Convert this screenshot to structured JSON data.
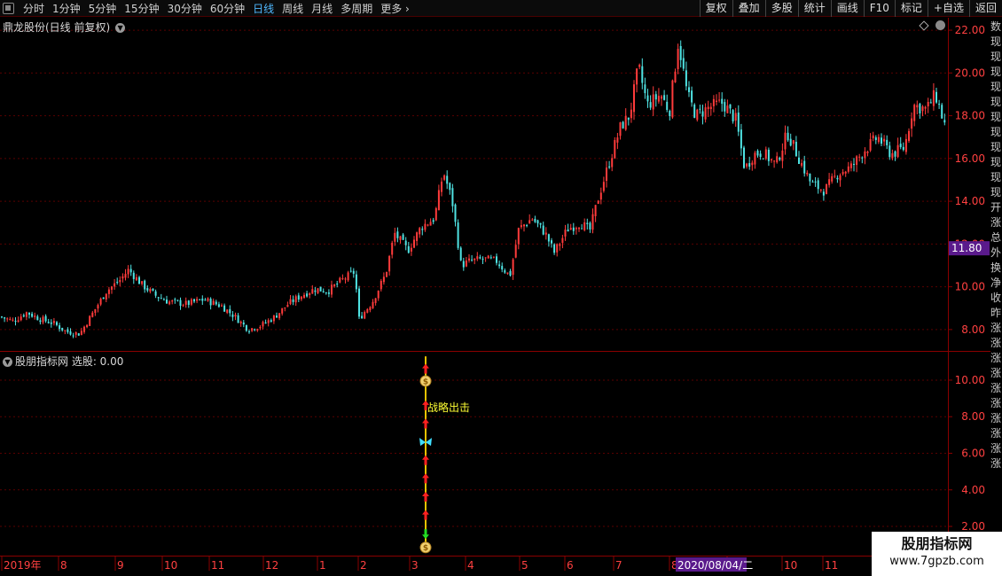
{
  "toolbar": {
    "periods": [
      "分时",
      "1分钟",
      "5分钟",
      "15分钟",
      "30分钟",
      "60分钟",
      "日线",
      "周线",
      "月线",
      "多周期",
      "更多 ›"
    ],
    "active_period": "日线",
    "right_tools": [
      "复权",
      "叠加",
      "多股",
      "统计",
      "画线",
      "F10",
      "标记",
      "+自选",
      "返回"
    ]
  },
  "price_panel": {
    "title": "鼎龙股份(日线 前复权)",
    "current_price_label": "11.80"
  },
  "indicator_panel": {
    "title": "股朋指标网  选股: 0.00",
    "annotation": "战略出击"
  },
  "x_axis": {
    "labels": [
      "2019年",
      "8",
      "9",
      "10",
      "11",
      "12",
      "1",
      "2",
      "3",
      "4",
      "5",
      "6",
      "7",
      "8",
      "9",
      "10",
      "11"
    ],
    "highlight_date": "2020/08/04/二"
  },
  "side_strip_chars": [
    "数",
    "现",
    "现",
    "现",
    "现",
    "现",
    "现",
    "现",
    "现",
    "现",
    "现",
    "现",
    "开",
    "涨",
    "总",
    "外",
    "换",
    "净",
    "收",
    "昨",
    "涨",
    "涨",
    "涨",
    "涨",
    "涨",
    "涨",
    "涨",
    "涨",
    "涨",
    "涨"
  ],
  "watermark": {
    "title": "股朋指标网",
    "url": "www.7gpzb.com"
  },
  "colors": {
    "up": "#ff3b3b",
    "down": "#4fe3e3",
    "grid": "#5a0000",
    "axis_text": "#ff4040",
    "highlight_bg": "#5a1a8c",
    "signal_label": "#ffff33"
  },
  "chart_data": [
    {
      "type": "candlestick",
      "title": "鼎龙股份(日线 前复权)",
      "ylim": [
        7,
        22.5
      ],
      "y_ticks": [
        8.0,
        10.0,
        12.0,
        14.0,
        16.0,
        18.0,
        20.0,
        22.0
      ],
      "current_price": 11.8,
      "close_path": [
        [
          0,
          8.6
        ],
        [
          15,
          8.4
        ],
        [
          30,
          8.8
        ],
        [
          45,
          8.5
        ],
        [
          60,
          8.3
        ],
        [
          75,
          7.9
        ],
        [
          90,
          7.8
        ],
        [
          105,
          8.8
        ],
        [
          120,
          9.8
        ],
        [
          135,
          10.3
        ],
        [
          145,
          10.8
        ],
        [
          160,
          10.1
        ],
        [
          175,
          9.6
        ],
        [
          190,
          9.3
        ],
        [
          210,
          9.2
        ],
        [
          230,
          9.4
        ],
        [
          250,
          9.1
        ],
        [
          265,
          8.6
        ],
        [
          280,
          8.0
        ],
        [
          295,
          8.2
        ],
        [
          310,
          8.6
        ],
        [
          325,
          9.2
        ],
        [
          340,
          9.6
        ],
        [
          355,
          9.9
        ],
        [
          370,
          9.8
        ],
        [
          385,
          10.3
        ],
        [
          400,
          10.7
        ],
        [
          405,
          8.5
        ],
        [
          420,
          9.3
        ],
        [
          435,
          10.6
        ],
        [
          445,
          12.5
        ],
        [
          460,
          11.7
        ],
        [
          475,
          12.8
        ],
        [
          490,
          13.2
        ],
        [
          500,
          15.4
        ],
        [
          510,
          14.0
        ],
        [
          520,
          11.0
        ],
        [
          530,
          11.2
        ],
        [
          545,
          11.3
        ],
        [
          560,
          11.2
        ],
        [
          575,
          10.5
        ],
        [
          585,
          12.7
        ],
        [
          600,
          13.2
        ],
        [
          615,
          12.5
        ],
        [
          625,
          11.6
        ],
        [
          640,
          12.7
        ],
        [
          655,
          13.0
        ],
        [
          665,
          12.6
        ],
        [
          675,
          14.2
        ],
        [
          690,
          16.2
        ],
        [
          700,
          17.5
        ],
        [
          710,
          18.0
        ],
        [
          720,
          20.3
        ],
        [
          730,
          18.5
        ],
        [
          745,
          19.0
        ],
        [
          755,
          18.2
        ],
        [
          765,
          21.5
        ],
        [
          775,
          19.0
        ],
        [
          785,
          18.0
        ],
        [
          800,
          18.4
        ],
        [
          815,
          18.6
        ],
        [
          830,
          17.8
        ],
        [
          840,
          15.5
        ],
        [
          850,
          16.2
        ],
        [
          860,
          16.3
        ],
        [
          875,
          15.7
        ],
        [
          888,
          17.2
        ],
        [
          900,
          16.1
        ],
        [
          915,
          14.8
        ],
        [
          930,
          14.5
        ],
        [
          945,
          15.3
        ],
        [
          960,
          15.6
        ],
        [
          975,
          16.4
        ],
        [
          990,
          17.0
        ],
        [
          1005,
          16.2
        ],
        [
          1020,
          16.5
        ],
        [
          1030,
          18.5
        ],
        [
          1045,
          18.3
        ],
        [
          1055,
          19.0
        ],
        [
          1065,
          17.6
        ]
      ]
    },
    {
      "type": "indicator",
      "name": "股朋指标网",
      "ylim": [
        0.5,
        11.5
      ],
      "y_ticks": [
        2.0,
        4.0,
        6.0,
        8.0,
        10.0
      ],
      "signal_x": 480,
      "up_arrows_y": [
        10.6,
        8.6,
        7.6,
        5.6,
        4.6,
        3.6,
        2.6
      ],
      "down_arrow_y": 1.6,
      "money_bags_y": [
        10.0,
        0.9
      ],
      "butterfly_y": 6.6,
      "label_y": 8.5
    }
  ]
}
